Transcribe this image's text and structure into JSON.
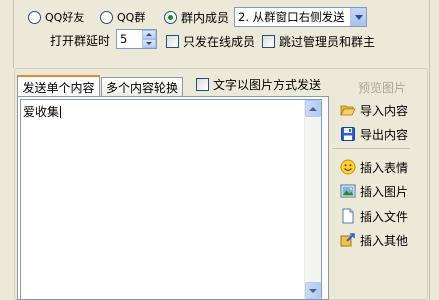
{
  "target": {
    "options": [
      {
        "label": "QQ好友",
        "checked": false
      },
      {
        "label": "QQ群",
        "checked": false
      },
      {
        "label": "群内成员",
        "checked": true
      }
    ],
    "member_mode": "2. 从群窗口右侧发送"
  },
  "delay": {
    "label": "打开群延时",
    "value": "5"
  },
  "options": {
    "online_only": "只发在线成员",
    "skip_admins": "跳过管理员和群主",
    "text_as_image": "文字以图片方式发送"
  },
  "tabs": [
    {
      "label": "发送单个内容",
      "active": true
    },
    {
      "label": "多个内容轮换",
      "active": false
    }
  ],
  "editor": {
    "text": "爱收集"
  },
  "side_buttons": {
    "preview": "预览图片",
    "import": "导入内容",
    "export": "导出内容",
    "emoji": "插入表情",
    "image": "插入图片",
    "file": "插入文件",
    "other": "插入其他"
  },
  "colors": {
    "background": "#ece9d8",
    "tab_accent": "#e68b2c",
    "control_border": "#7f9db9"
  }
}
